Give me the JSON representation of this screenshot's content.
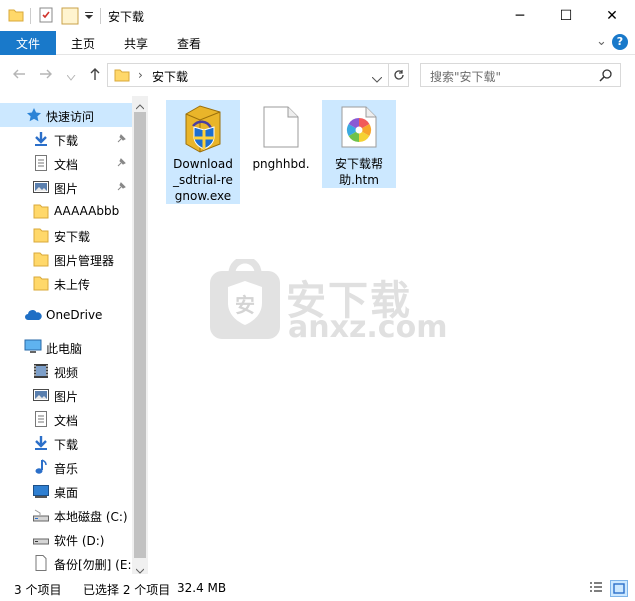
{
  "window": {
    "title": "安下载",
    "minimize_glyph": "─",
    "maximize_glyph": "☐",
    "close_glyph": "✕"
  },
  "ribbon": {
    "tabs": [
      "文件",
      "主页",
      "共享",
      "查看"
    ],
    "expand_glyph": "⌄",
    "help_glyph": "?"
  },
  "address": {
    "path": "安下载",
    "separator": "›",
    "search_placeholder": "搜索\"安下载\""
  },
  "nav": {
    "quick_access": "快速访问",
    "items": [
      {
        "label": "下载",
        "icon": "download-arrow-icon",
        "pinned": true
      },
      {
        "label": "文档",
        "icon": "document-icon",
        "pinned": true
      },
      {
        "label": "图片",
        "icon": "picture-icon",
        "pinned": true
      },
      {
        "label": "AAAAAbbb",
        "icon": "folder-icon"
      },
      {
        "label": "安下载",
        "icon": "folder-icon"
      },
      {
        "label": "图片管理器",
        "icon": "folder-icon"
      },
      {
        "label": "未上传",
        "icon": "folder-icon"
      }
    ],
    "onedrive": "OneDrive",
    "this_pc": "此电脑",
    "pc_items": [
      {
        "label": "视频",
        "icon": "video-icon"
      },
      {
        "label": "图片",
        "icon": "picture-icon"
      },
      {
        "label": "文档",
        "icon": "document-icon"
      },
      {
        "label": "下载",
        "icon": "download-arrow-icon"
      },
      {
        "label": "音乐",
        "icon": "music-note-icon"
      },
      {
        "label": "桌面",
        "icon": "desktop-icon"
      },
      {
        "label": "本地磁盘 (C:)",
        "icon": "drive-icon"
      },
      {
        "label": "软件 (D:)",
        "icon": "drive-icon"
      },
      {
        "label": "备份[勿删] (E:)",
        "icon": "drive-icon"
      }
    ]
  },
  "files": [
    {
      "name": "Download_sdtrial-regnow.exe",
      "lines": [
        "Download",
        "_sdtrial-re",
        "gnow.exe"
      ],
      "icon": "installer-box-icon",
      "selected": true
    },
    {
      "name": "pnghhbd.",
      "lines": [
        "pnghhbd."
      ],
      "icon": "blank-file-icon",
      "selected": false
    },
    {
      "name": "安下载帮助.htm",
      "lines": [
        "安下载帮",
        "助.htm"
      ],
      "icon": "html-file-icon",
      "selected": true
    }
  ],
  "watermark": {
    "cn": "安下载",
    "en": "anxz.com",
    "shield_char": "安"
  },
  "status": {
    "count": "3 个项目",
    "selected": "已选择 2 个项目",
    "size": "32.4 MB"
  },
  "colors": {
    "accent": "#1979ca",
    "selection": "#cce8ff",
    "folder": "#ffd86a"
  }
}
